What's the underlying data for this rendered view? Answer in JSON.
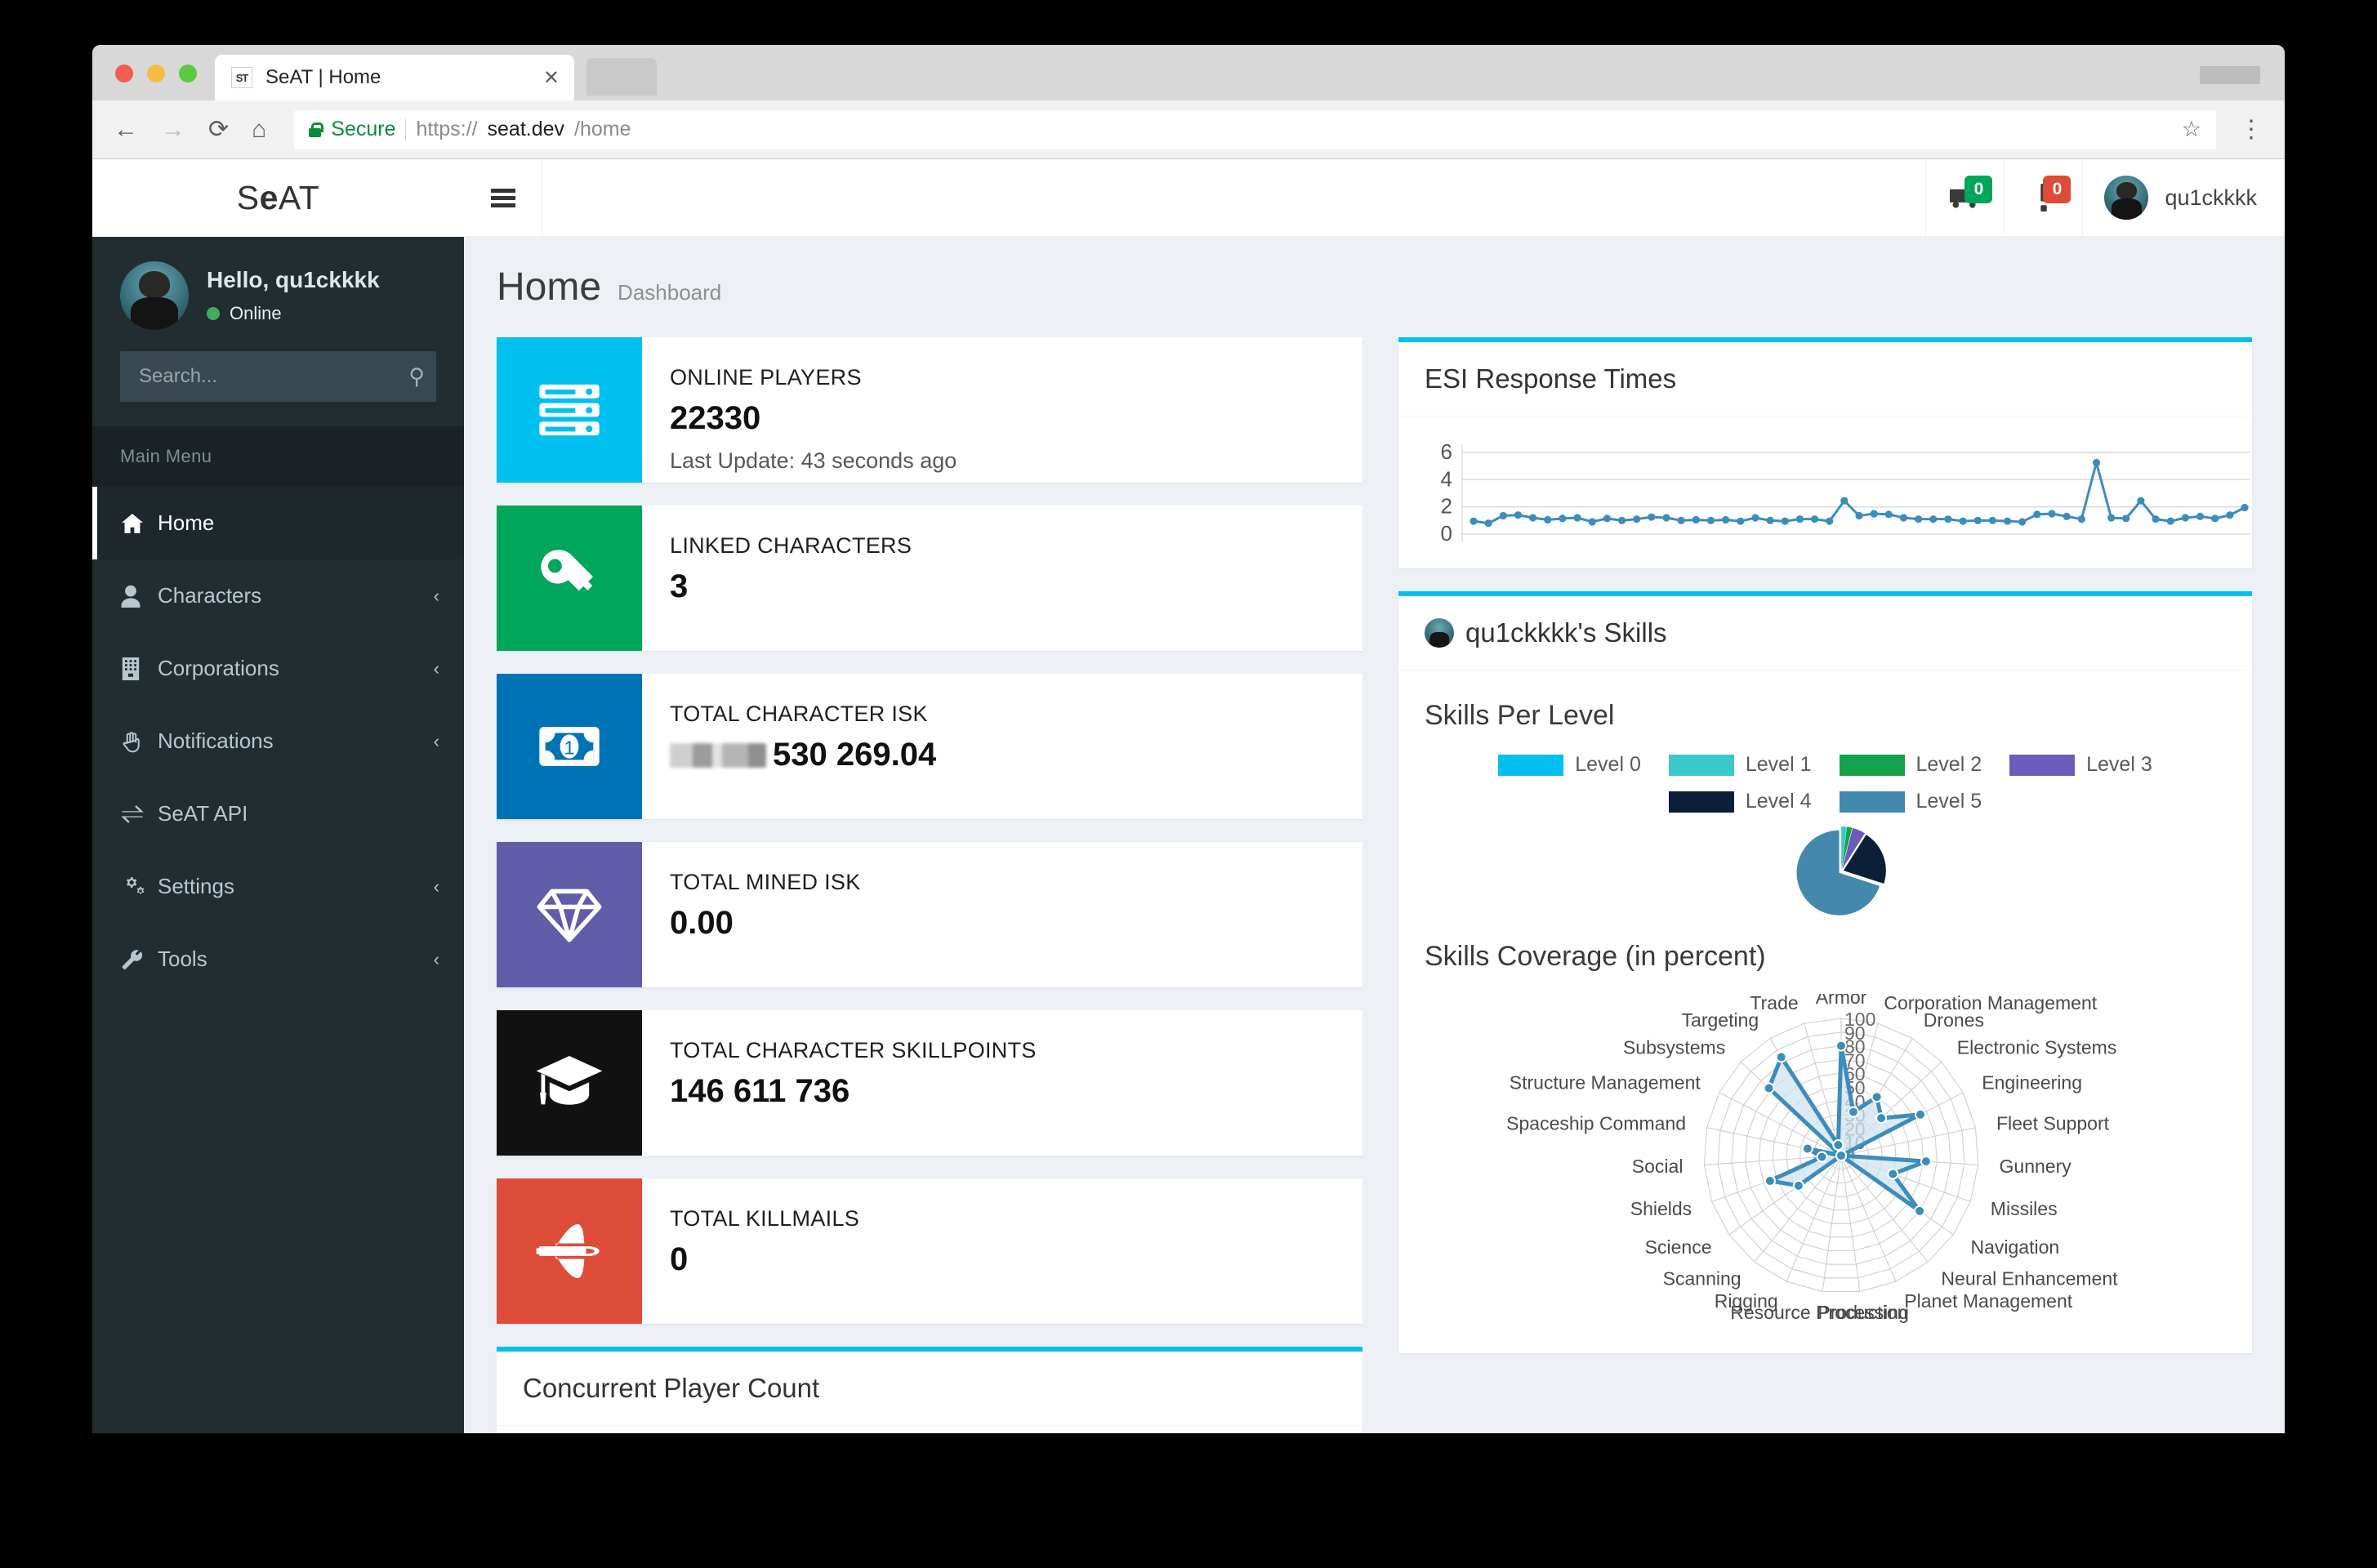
{
  "browser": {
    "tab_title": "SeAT | Home",
    "favicon_text": "ST",
    "close_glyph": "✕",
    "back_glyph": "←",
    "forward_glyph": "→",
    "reload_glyph": "⟳",
    "home_glyph": "⌂",
    "security_label": "Secure",
    "url_scheme": "https://",
    "url_host": "seat.dev",
    "url_path": "/home",
    "star_glyph": "☆",
    "menu_glyph": "⋮"
  },
  "sidebar": {
    "brand_pre": "S",
    "brand_bold": "e",
    "brand_post": "AT",
    "greeting": "Hello, qu1ckkkk",
    "status": "Online",
    "search_placeholder": "Search...",
    "search_value": "",
    "section_label": "Main Menu",
    "items": [
      {
        "label": "Home",
        "icon": "home-icon",
        "glyph": "⌂",
        "active": true,
        "chevron": ""
      },
      {
        "label": "Characters",
        "icon": "user-icon",
        "glyph": "●",
        "active": false,
        "chevron": "‹"
      },
      {
        "label": "Corporations",
        "icon": "building-icon",
        "glyph": "▦",
        "active": false,
        "chevron": "‹"
      },
      {
        "label": "Notifications",
        "icon": "hand-icon",
        "glyph": "✋",
        "active": false,
        "chevron": "‹"
      },
      {
        "label": "SeAT API",
        "icon": "exchange-icon",
        "glyph": "⇄",
        "active": false,
        "chevron": ""
      },
      {
        "label": "Settings",
        "icon": "gears-icon",
        "glyph": "⚙",
        "active": false,
        "chevron": "‹"
      },
      {
        "label": "Tools",
        "icon": "wrench-icon",
        "glyph": "🔧",
        "active": false,
        "chevron": "‹"
      }
    ]
  },
  "topnav": {
    "burger_name": "menu-toggle",
    "truck_badge": "0",
    "truck_badge_color": "#00a65a",
    "alert_badge": "0",
    "alert_badge_color": "#dd4b39",
    "username": "qu1ckkkk"
  },
  "page": {
    "title": "Home",
    "subtitle": "Dashboard"
  },
  "stats": [
    {
      "label": "ONLINE PLAYERS",
      "value": "22330",
      "note": "Last Update: 43 seconds ago",
      "color": "#00c0ef",
      "icon": "server-icon",
      "redacted": false
    },
    {
      "label": "LINKED CHARACTERS",
      "value": "3",
      "note": "",
      "color": "#00a65a",
      "icon": "key-icon",
      "redacted": false
    },
    {
      "label": "TOTAL CHARACTER ISK",
      "value": "530 269.04",
      "note": "",
      "color": "#0073b7",
      "icon": "money-bill-icon",
      "redacted": true
    },
    {
      "label": "TOTAL MINED ISK",
      "value": "0.00",
      "note": "",
      "color": "#605ca8",
      "icon": "gem-icon",
      "redacted": false
    },
    {
      "label": "TOTAL CHARACTER SKILLPOINTS",
      "value": "146 611 736",
      "note": "",
      "color": "#111111",
      "icon": "graduation-cap-icon",
      "redacted": false
    },
    {
      "label": "TOTAL KILLMAILS",
      "value": "0",
      "note": "",
      "color": "#dd4b39",
      "icon": "space-shuttle-icon",
      "redacted": false
    }
  ],
  "concurrent_card": {
    "title": "Concurrent Player Count",
    "accent": "#00c0ef"
  },
  "esi_card": {
    "title": "ESI Response Times",
    "accent": "#00c0ef"
  },
  "skills_card": {
    "title": "qu1ckkkk's Skills",
    "accent": "#00c0ef",
    "per_level_title": "Skills Per Level",
    "coverage_title": "Skills Coverage (in percent)"
  },
  "chart_data": [
    {
      "type": "line",
      "title": "ESI Response Times",
      "xlabel": "",
      "ylabel": "",
      "ylim": [
        0,
        6.6
      ],
      "yticks": [
        0,
        2,
        4,
        6
      ],
      "grid": true,
      "legend": "none",
      "line_color": "#3c8dbc",
      "values": [
        0.95,
        0.8,
        1.35,
        1.4,
        1.2,
        1.05,
        1.15,
        1.2,
        0.9,
        1.15,
        1.0,
        1.1,
        1.25,
        1.2,
        1.0,
        1.05,
        1.0,
        1.05,
        0.95,
        1.2,
        1.0,
        0.95,
        1.1,
        1.1,
        0.95,
        2.45,
        1.35,
        1.5,
        1.45,
        1.2,
        1.1,
        1.1,
        1.1,
        0.95,
        1.0,
        1.0,
        0.95,
        0.9,
        1.45,
        1.5,
        1.3,
        1.1,
        5.25,
        1.2,
        1.15,
        2.45,
        1.1,
        0.95,
        1.2,
        1.3,
        1.15,
        1.4,
        1.95
      ]
    },
    {
      "type": "pie",
      "title": "Skills Per Level",
      "legend": "top",
      "labels": [
        "Level 0",
        "Level 1",
        "Level 2",
        "Level 3",
        "Level 4",
        "Level 5"
      ],
      "colors": [
        "#00c0ef",
        "#3bc8c8",
        "#15a34a",
        "#6a5bbd",
        "#0c1f38",
        "#4389ae"
      ],
      "values": [
        0,
        2,
        2,
        5,
        21,
        70
      ]
    },
    {
      "type": "radar",
      "title": "Skills Coverage (in percent)",
      "rlim": [
        0,
        100
      ],
      "rticks": [
        0,
        10,
        20,
        30,
        40,
        50,
        60,
        70,
        80,
        90,
        100
      ],
      "fill_color": "#cfe3ef",
      "line_color": "#3c8dbc",
      "categories": [
        "Armor",
        "Corporation Management",
        "Drones",
        "Electronic Systems",
        "Engineering",
        "Fleet Support",
        "Gunnery",
        "Missiles",
        "Navigation",
        "Neural Enhancement",
        "Planet Management",
        "Production",
        "Resource Processing",
        "Rigging",
        "Scanning",
        "Science",
        "Shields",
        "Social",
        "Spaceship Command",
        "Structure Management",
        "Subsystems",
        "Targeting",
        "Trade"
      ],
      "values": [
        80,
        33,
        50,
        40,
        65,
        0,
        62,
        40,
        70,
        0,
        0,
        0,
        0,
        0,
        0,
        38,
        55,
        14,
        25,
        0,
        72,
        84,
        8
      ]
    }
  ]
}
